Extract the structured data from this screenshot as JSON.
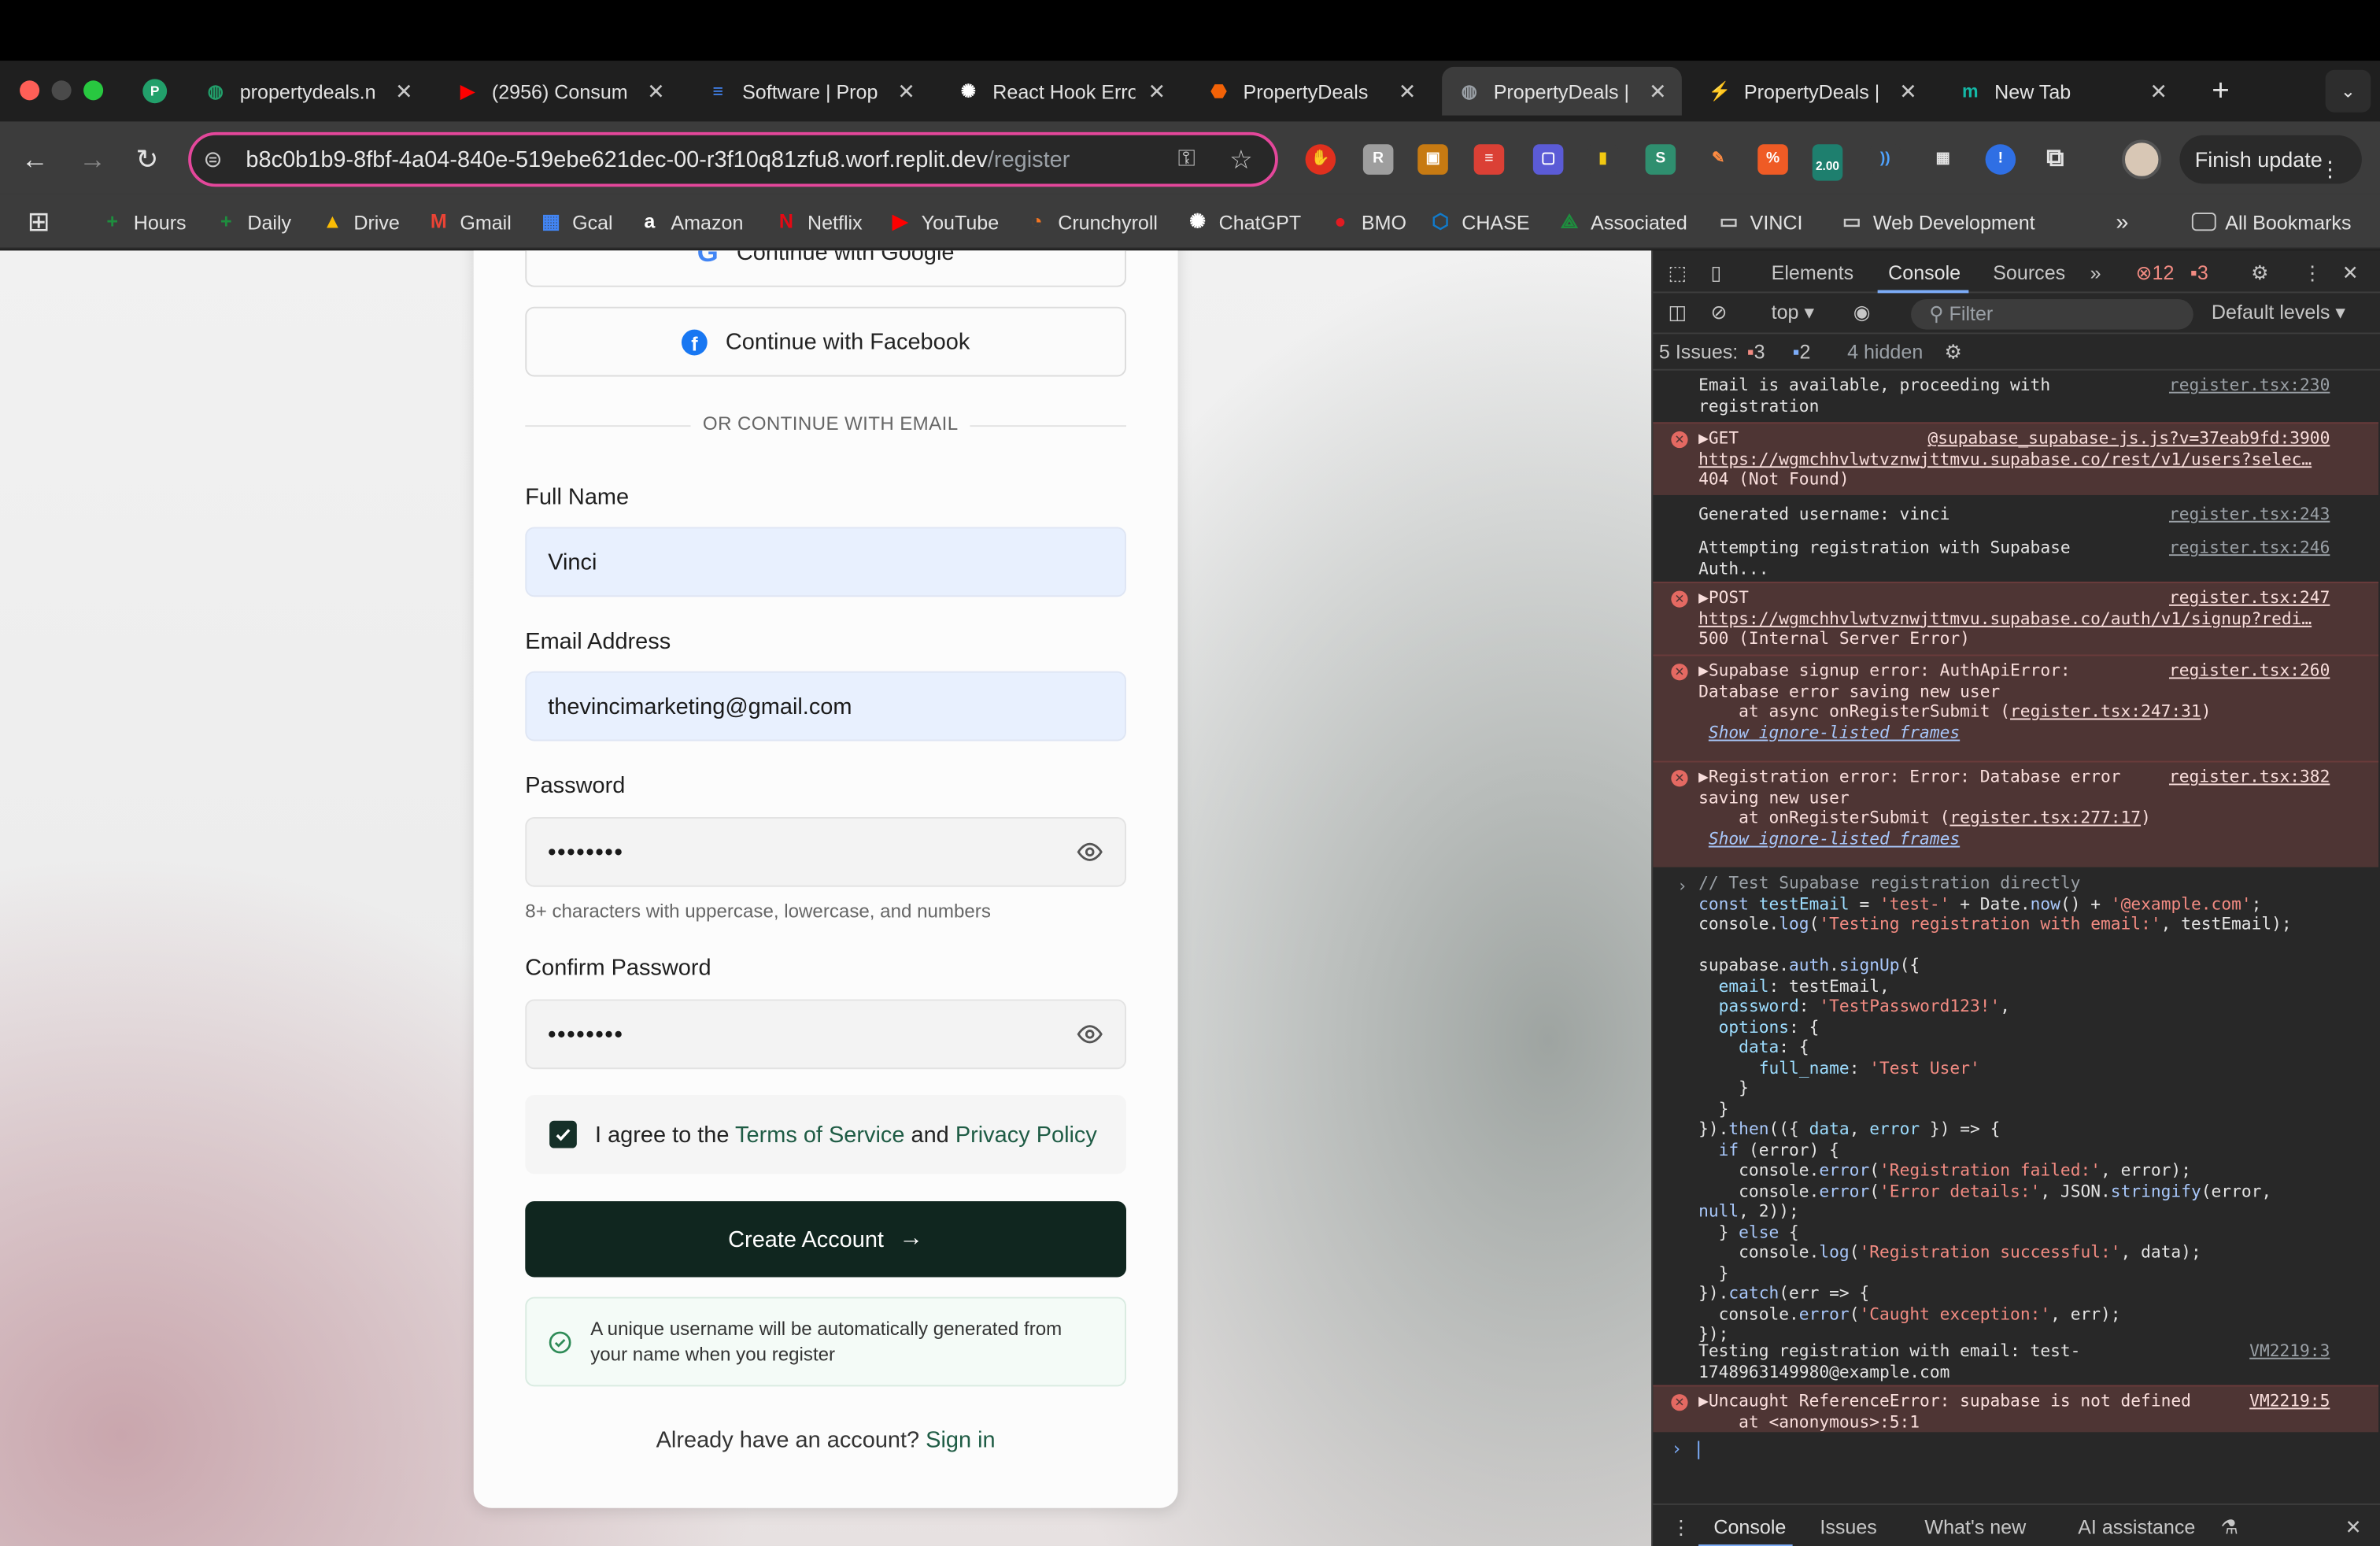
{
  "browser": {
    "tabs": [
      {
        "label": "propertydeals.n",
        "icon": "globe-icon",
        "color": "#22a06b",
        "active": false
      },
      {
        "label": "(2956) Consum",
        "icon": "youtube-icon",
        "color": "#ff0000",
        "active": false
      },
      {
        "label": "Software | Prop",
        "icon": "docs-icon",
        "color": "#4285f4",
        "active": false
      },
      {
        "label": "React Hook Erro",
        "icon": "openai-icon",
        "color": "#ffffff",
        "active": false
      },
      {
        "label": "PropertyDeals",
        "icon": "replit-icon",
        "color": "#f26207",
        "active": false
      },
      {
        "label": "PropertyDeals |",
        "icon": "globe-icon",
        "color": "#9aa0a6",
        "active": true
      },
      {
        "label": "PropertyDeals |",
        "icon": "bolt-icon",
        "color": "#22c55e",
        "active": false
      },
      {
        "label": "New Tab",
        "icon": "m-icon",
        "color": "#14b8a6",
        "active": false
      }
    ],
    "url_host": "b8c0b1b9-8fbf-4a04-840e-519ebe621dec-00-r3f10q81zfu8.worf.replit.dev",
    "url_path": "/register",
    "finish_update": "Finish update",
    "ext_badge": "2.00",
    "bookmarks": [
      {
        "label": "Hours",
        "icon": "plus-icon",
        "color": "#1e8e3e"
      },
      {
        "label": "Daily",
        "icon": "plus-icon",
        "color": "#1e8e3e"
      },
      {
        "label": "Drive",
        "icon": "drive-icon",
        "color": "#fbbc04"
      },
      {
        "label": "Gmail",
        "icon": "gmail-icon",
        "color": "#ea4335"
      },
      {
        "label": "Gcal",
        "icon": "calendar-icon",
        "color": "#4285f4"
      },
      {
        "label": "Amazon",
        "icon": "amazon-icon",
        "color": "#ffffff"
      },
      {
        "label": "Netflix",
        "icon": "netflix-icon",
        "color": "#e50914"
      },
      {
        "label": "YouTube",
        "icon": "youtube-icon",
        "color": "#ff0000"
      },
      {
        "label": "Crunchyroll",
        "icon": "crunchyroll-icon",
        "color": "#f47521"
      },
      {
        "label": "ChatGPT",
        "icon": "openai-icon",
        "color": "#ffffff"
      },
      {
        "label": "BMO",
        "icon": "bmo-icon",
        "color": "#e11b22"
      },
      {
        "label": "CHASE",
        "icon": "chase-icon",
        "color": "#117aca"
      },
      {
        "label": "Associated",
        "icon": "associated-icon",
        "color": "#1e8e3e"
      },
      {
        "label": "VINCI",
        "icon": "folder-icon",
        "color": "#c8c8c8"
      },
      {
        "label": "Web Development",
        "icon": "folder-icon",
        "color": "#c8c8c8"
      }
    ],
    "all_bookmarks": "All Bookmarks"
  },
  "form": {
    "google": "Continue with Google",
    "facebook": "Continue with Facebook",
    "divider": "OR CONTINUE WITH EMAIL",
    "full_name_label": "Full Name",
    "full_name_value": "Vinci",
    "email_label": "Email Address",
    "email_value": "thevincimarketing@gmail.com",
    "password_label": "Password",
    "password_value": "••••••••",
    "password_hint": "8+ characters with uppercase, lowercase, and numbers",
    "confirm_label": "Confirm Password",
    "confirm_value": "••••••••",
    "terms_prefix": "I agree to the",
    "terms_link": "Terms of Service",
    "terms_and": "and",
    "privacy_link": "Privacy Policy",
    "create_button": "Create Account",
    "notice": "A unique username will be automatically generated from your name when you register",
    "signin_prompt": "Already have an account?",
    "signin_link": "Sign in",
    "accent": "#10261f"
  },
  "devtools": {
    "tabs": [
      "Elements",
      "Console",
      "Sources"
    ],
    "error_count": "12",
    "warning_count": "3",
    "context": "top",
    "filter_placeholder": "Filter",
    "levels": "Default levels",
    "issues_label": "5 Issues:",
    "issues_errors": "3",
    "issues_info": "2",
    "hidden": "4 hidden",
    "drawer_tabs": [
      "Console",
      "Issues",
      "What's new",
      "AI assistance"
    ],
    "messages": {
      "m1": "Email is available, proceeding with\nregistration",
      "m1_src": "register.tsx:230",
      "m2_head": "▶GET",
      "m2_src": "@supabase_supabase-js.js?v=37eab9fd:3900",
      "m2_url": "https://wgmchhvlwtvznwjttmvu.supabase.co/rest/v1/users?selec…",
      "m2_status": "404 (Not Found)",
      "m3": "Generated username: vinci",
      "m3_src": "register.tsx:243",
      "m4": "Attempting registration with Supabase\nAuth...",
      "m4_src": "register.tsx:246",
      "m5_head": "▶POST",
      "m5_src": "register.tsx:247",
      "m5_url": "https://wgmchhvlwtvznwjttmvu.supabase.co/auth/v1/signup?redi…",
      "m5_status": "500 (Internal Server Error)",
      "m6_head": "▶Supabase signup error: AuthApiError:\nDatabase error saving new user\n    at async onRegisterSubmit (",
      "m6_link": "register.tsx:247:31",
      "m6_tail": ")",
      "m6_src": "register.tsx:260",
      "m6_ignore": "Show ignore-listed frames",
      "m7_head": "▶Registration error: Error: Database error\nsaving new user\n    at onRegisterSubmit (",
      "m7_link": "register.tsx:277:17",
      "m7_tail": ")",
      "m7_src": "register.tsx:382",
      "m7_ignore": "Show ignore-listed frames",
      "m8": "Testing registration with email: test-\n1748963149980@example.com",
      "m8_src": "VM2219:3",
      "m9": "▶Uncaught ReferenceError: supabase is not defined\n    at <anonymous>:5:1",
      "m9_src": "VM2219:5"
    }
  }
}
